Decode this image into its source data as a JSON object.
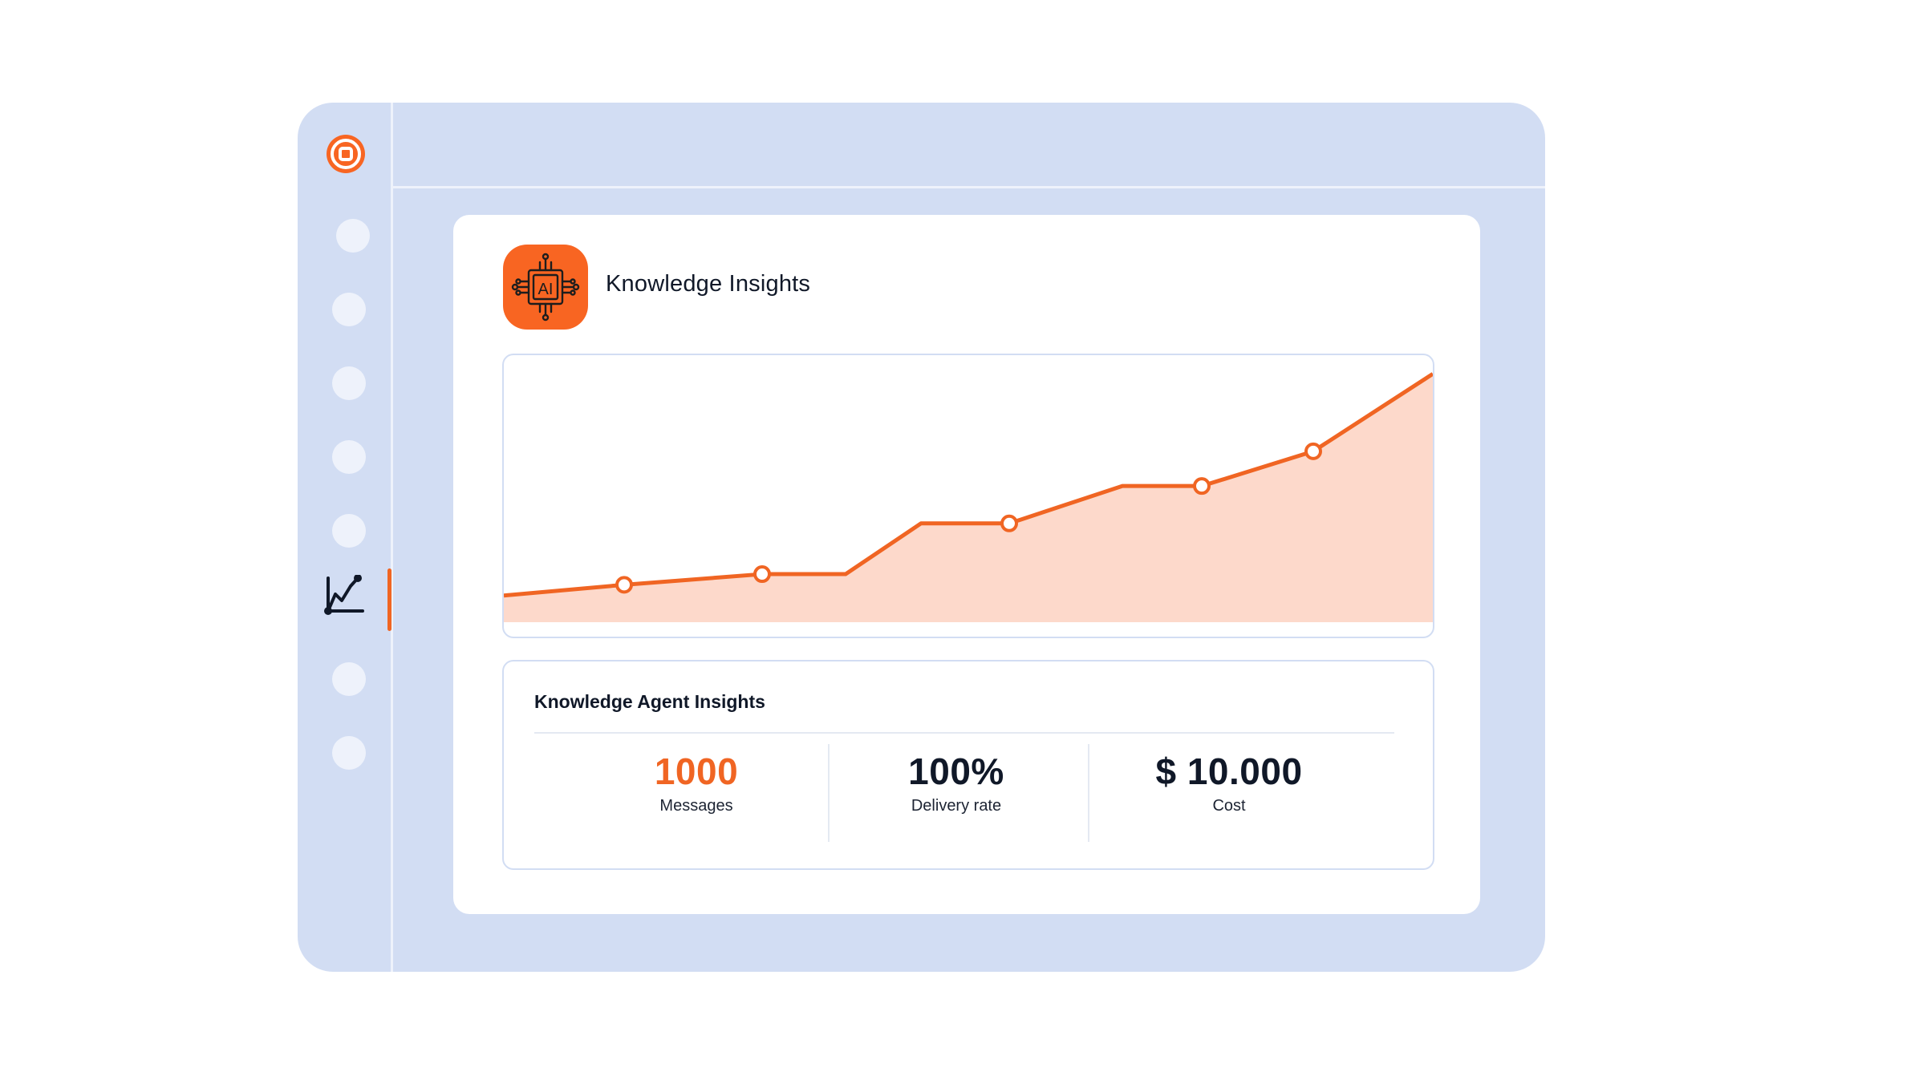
{
  "card": {
    "title": "Knowledge Insights",
    "app_icon_text": "AI"
  },
  "sidebar": {
    "items": [
      "nav-1",
      "nav-2",
      "nav-3",
      "nav-4",
      "nav-5",
      "analytics",
      "nav-7",
      "nav-8"
    ],
    "active_item": "analytics"
  },
  "colors": {
    "accent": "#f86522",
    "line": "#f06523",
    "area_fill": "#fdd9cb",
    "window_bg": "#d2ddf3",
    "nav_dot": "#eef2fb"
  },
  "chart_data": {
    "type": "area",
    "y": [
      0.1,
      0.14,
      0.18,
      0.18,
      0.37,
      0.37,
      0.51,
      0.51,
      0.64,
      0.93
    ],
    "marked_points": [
      1,
      2,
      5,
      7,
      8
    ],
    "grid": false,
    "legend": "none"
  },
  "insights": {
    "title": "Knowledge Agent Insights",
    "stats": [
      {
        "value": "1000",
        "label": "Messages",
        "color": "#f06523"
      },
      {
        "value": "100%",
        "label": "Delivery rate",
        "color": "#101828"
      },
      {
        "value": "$ 10.000",
        "label": "Cost",
        "color": "#101828"
      }
    ]
  }
}
